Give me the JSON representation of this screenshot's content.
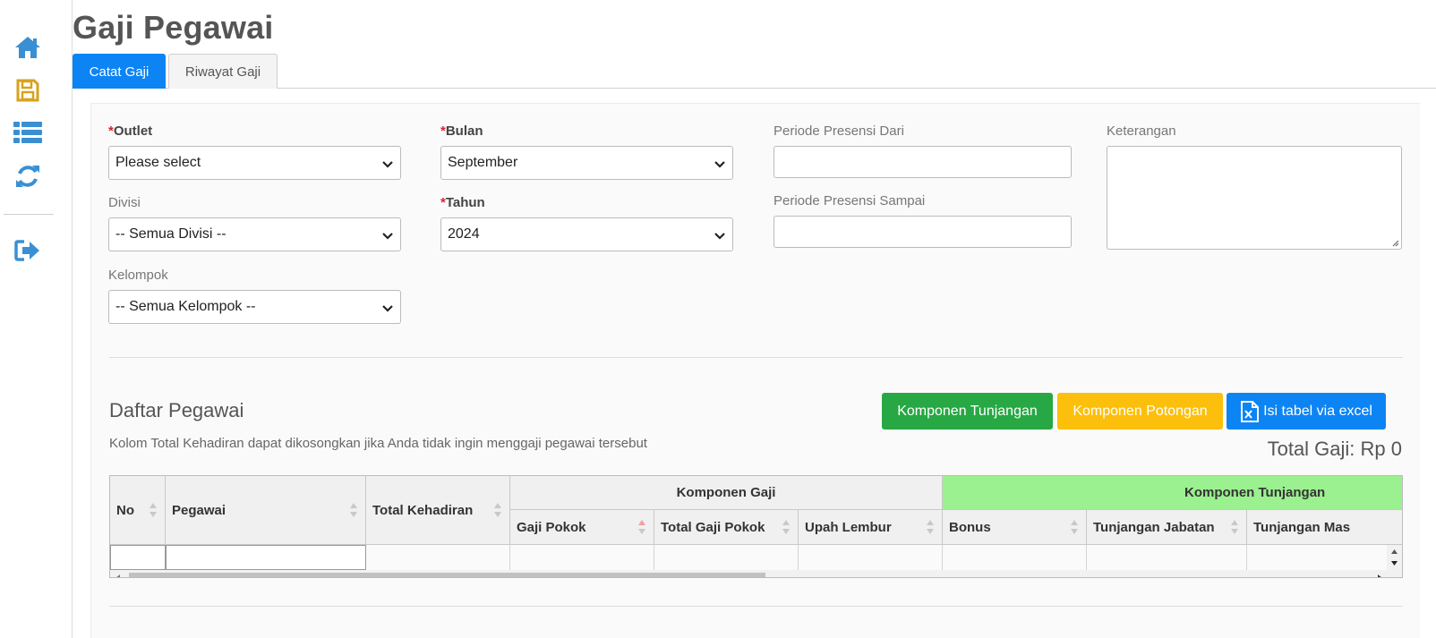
{
  "page": {
    "title": "Gaji Pegawai"
  },
  "sidebar": {
    "icons": [
      "home-icon",
      "save-icon",
      "list-icon",
      "refresh-icon",
      "logout-icon"
    ],
    "colors": {
      "blue": "#3a8fd3",
      "gold": "#d9a21b"
    }
  },
  "tabs": [
    {
      "label": "Catat Gaji",
      "active": true
    },
    {
      "label": "Riwayat Gaji",
      "active": false
    }
  ],
  "form": {
    "outlet": {
      "label": "Outlet",
      "value": "Please select"
    },
    "divisi": {
      "label": "Divisi",
      "value": "-- Semua Divisi --"
    },
    "kelompok": {
      "label": "Kelompok",
      "value": "-- Semua Kelompok --"
    },
    "bulan": {
      "label": "Bulan",
      "value": "September"
    },
    "tahun": {
      "label": "Tahun",
      "value": "2024"
    },
    "periode_dari": {
      "label": "Periode Presensi Dari",
      "value": ""
    },
    "periode_sampai": {
      "label": "Periode Presensi Sampai",
      "value": ""
    },
    "keterangan": {
      "label": "Keterangan",
      "value": ""
    },
    "required_marker": "*"
  },
  "employees": {
    "title": "Daftar Pegawai",
    "subtitle": "Kolom Total Kehadiran dapat dikosongkan jika Anda tidak ingin menggaji pegawai tersebut",
    "total": "Total Gaji: Rp 0",
    "buttons": {
      "tunjangan": "Komponen Tunjangan",
      "potongan": "Komponen Potongan",
      "excel": "Isi tabel via excel"
    },
    "colors": {
      "green": "#27a844",
      "yellow": "#fcbf0b",
      "blue": "#0d84f4",
      "tunjangan_header": "#9bf08f"
    }
  },
  "table": {
    "groups": {
      "komponen_gaji": "Komponen Gaji",
      "komponen_tunjangan": "Komponen Tunjangan"
    },
    "columns": {
      "no": "No",
      "pegawai": "Pegawai",
      "total_kehadiran": "Total Kehadiran",
      "gaji_pokok": "Gaji Pokok",
      "total_gaji_pokok": "Total Gaji Pokok",
      "upah_lembur": "Upah Lembur",
      "bonus": "Bonus",
      "tunjangan_jabatan": "Tunjangan Jabatan",
      "tunjangan_mas": "Tunjangan Mas"
    }
  }
}
